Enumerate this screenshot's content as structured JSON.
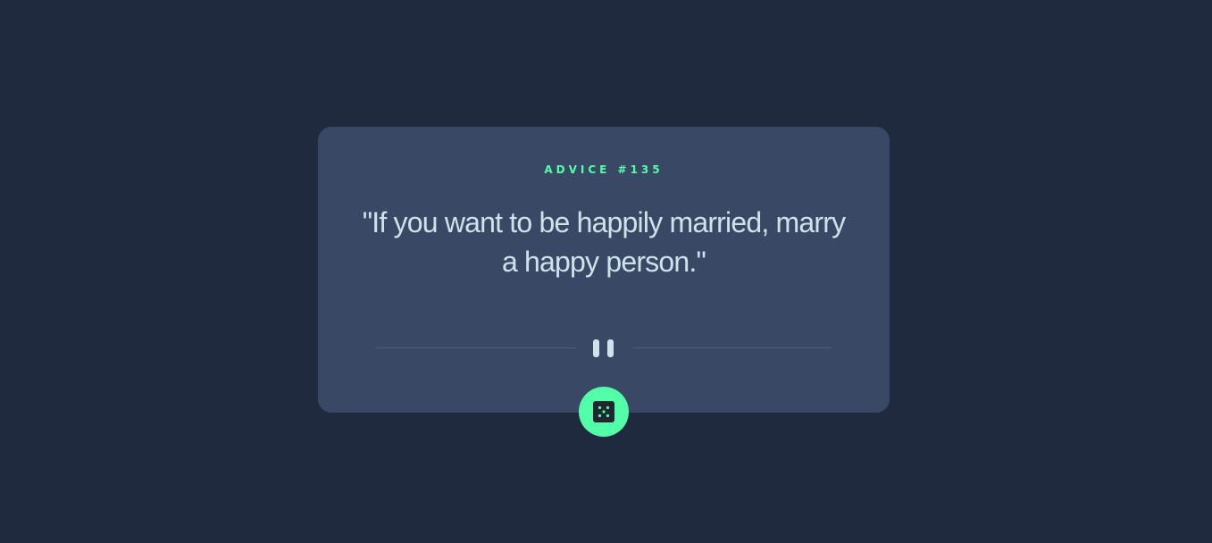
{
  "card": {
    "advice_label": "ADVICE #135",
    "quote": "\"If you want to be happily married, marry a happy person.\""
  },
  "icons": {
    "divider": "pause-icon",
    "button": "dice-icon"
  },
  "colors": {
    "background": "#202a3f",
    "card": "#394965",
    "accent": "#52ffa8",
    "text": "#cee3e9",
    "divider": "#4f5d74"
  }
}
